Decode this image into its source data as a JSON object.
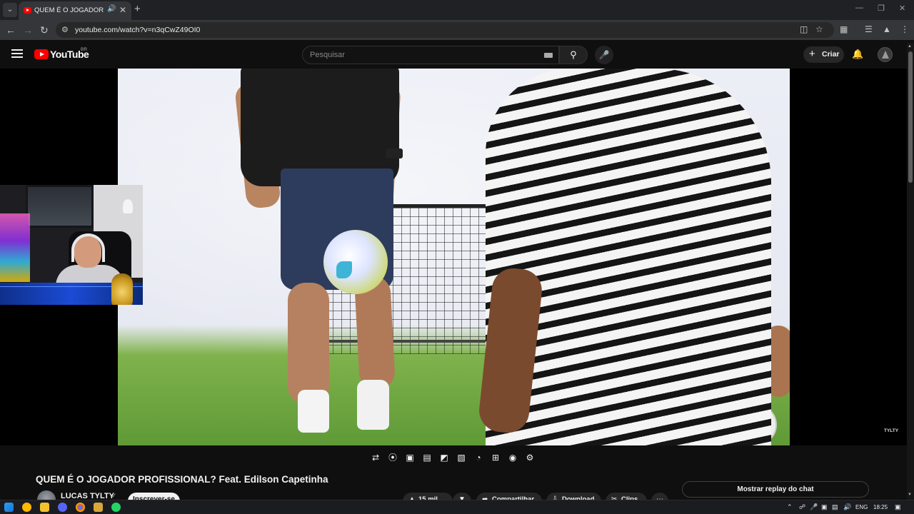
{
  "browser": {
    "tab_title": "QUEM É O JOGADOR PROFISSIONAL? Feat. Edilson Capetinha",
    "url": "youtube.com/watch?v=n3qCwZ49OI0",
    "new_tab_symbol": "+"
  },
  "youtube": {
    "logo_text": "YouTube",
    "country_code": "BR",
    "search_placeholder": "Pesquisar",
    "create_label": "Criar"
  },
  "video": {
    "watermark": "TYLTY",
    "title": "QUEM É O JOGADOR PROFISSIONAL? Feat. Edilson Capetinha"
  },
  "channel": {
    "name": "LUCAS TYLTY",
    "subscribe_label": "Inscrever-se"
  },
  "actions": {
    "likes": "15 mil",
    "share": "Compartilhar",
    "download": "Download",
    "clips": "Clips"
  },
  "chat": {
    "replay_label": "Mostrar replay do chat"
  },
  "taskbar": {
    "language": "ENG",
    "time": "18:25"
  },
  "colors": {
    "yt_red": "#ff0000",
    "page_bg": "#0f0f0f",
    "chip_bg": "#272727"
  }
}
